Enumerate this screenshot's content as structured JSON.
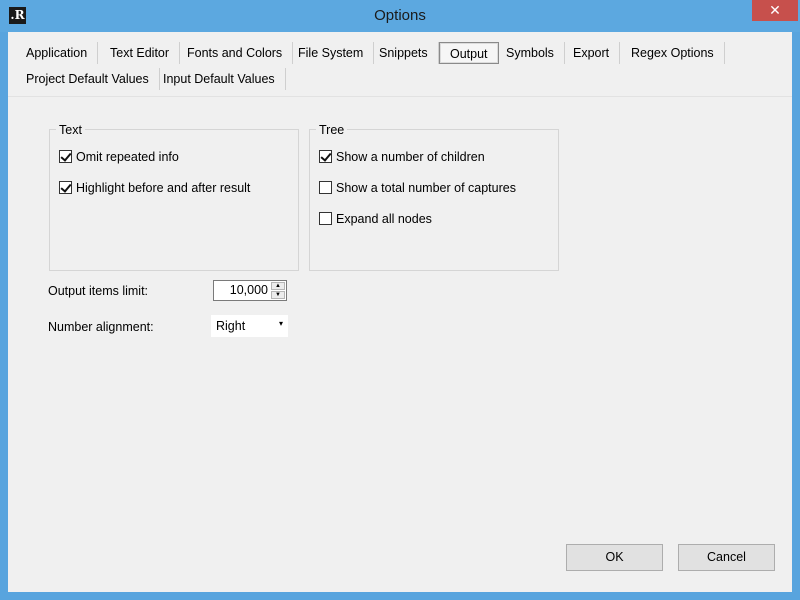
{
  "window": {
    "title": "Options",
    "icon_text": ".R",
    "close_glyph": "✕"
  },
  "tabs": [
    {
      "label": "Application"
    },
    {
      "label": "Text Editor"
    },
    {
      "label": "Fonts and Colors"
    },
    {
      "label": "File System"
    },
    {
      "label": "Snippets"
    },
    {
      "label": "Output",
      "active": true
    },
    {
      "label": "Symbols"
    },
    {
      "label": "Export"
    },
    {
      "label": "Regex Options"
    },
    {
      "label": "Project Default Values"
    },
    {
      "label": "Input Default Values"
    }
  ],
  "text_group": {
    "title": "Text",
    "options": [
      {
        "label": "Omit repeated info",
        "checked": true
      },
      {
        "label": "Highlight before and after result",
        "checked": true
      }
    ]
  },
  "tree_group": {
    "title": "Tree",
    "options": [
      {
        "label": "Show a number of children",
        "checked": true
      },
      {
        "label": "Show a total number of captures",
        "checked": false
      },
      {
        "label": "Expand all nodes",
        "checked": false
      }
    ]
  },
  "output_limit": {
    "label": "Output items limit:",
    "value": "10,000",
    "up_glyph": "▲",
    "down_glyph": "▼"
  },
  "number_alignment": {
    "label": "Number alignment:",
    "value": "Right",
    "arrow_glyph": "▾"
  },
  "buttons": {
    "ok": "OK",
    "cancel": "Cancel"
  }
}
